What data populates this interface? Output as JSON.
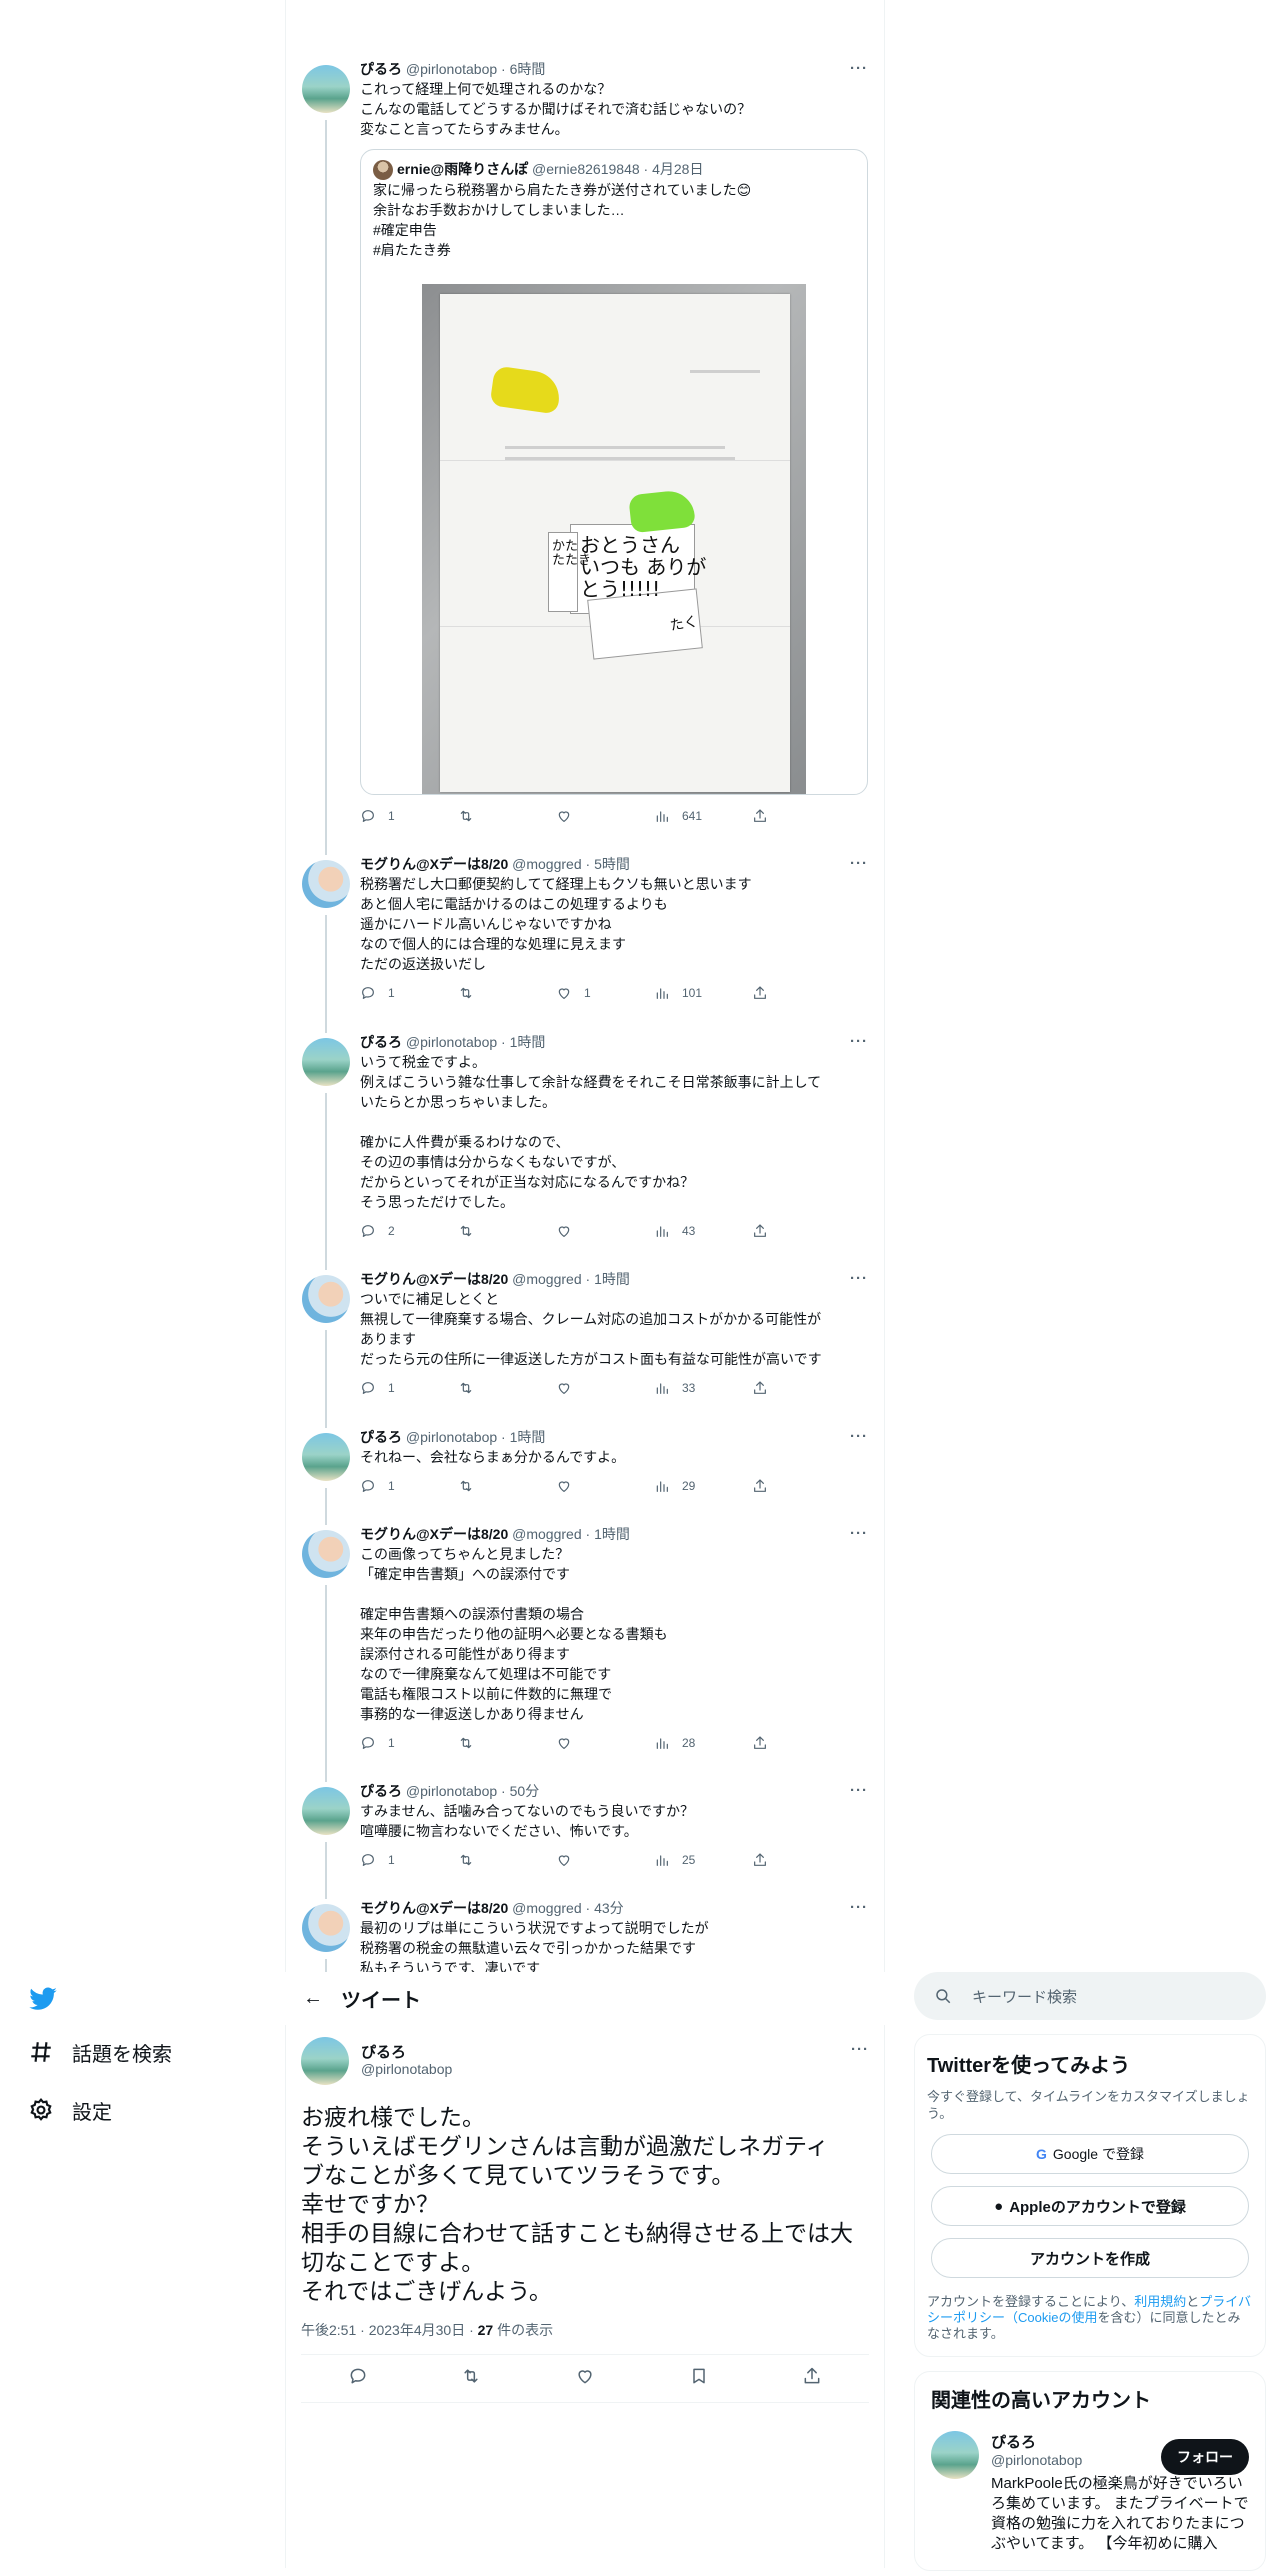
{
  "nav": {
    "explore_label": "話題を検索",
    "settings_label": "設定"
  },
  "header": {
    "title": "ツイート"
  },
  "thread": [
    {
      "name": "ぴるろ",
      "handle": "@pirlonotabop",
      "time": "6時間",
      "avatar": "pirlo",
      "text": "これって経理上何で処理されるのかな？\nこんなの電話してどうするか聞けばそれで済む話じゃないの？\n変なこと言ってたらすみません。",
      "quote": {
        "name": "ernie@雨降りさんぽ",
        "handle": "@ernie82619848",
        "time": "4月28日",
        "text": "家に帰ったら税務署から肩たたき券が送付されていました😊\n余計なお手数おかけしてしまいました…\n#確定申告\n#肩たたき券",
        "photo": {
          "card_left": "かた\nたたき",
          "card_main": "おとうさん\nいつも ありが\nとう!!!!!",
          "card_tail": "たく"
        }
      },
      "replies": "1",
      "retweets": "",
      "likes": "",
      "views": "641"
    },
    {
      "name": "モグりん@Xデーは8/20",
      "handle": "@moggred",
      "time": "5時間",
      "avatar": "mogg",
      "text": "税務署だし大口郵便契約してて経理上もクソも無いと思います\nあと個人宅に電話かけるのはこの処理するよりも\n遥かにハードル高いんじゃないですかね\nなので個人的には合理的な処理に見えます\nただの返送扱いだし",
      "replies": "1",
      "retweets": "",
      "likes": "1",
      "views": "101"
    },
    {
      "name": "ぴるろ",
      "handle": "@pirlonotabop",
      "time": "1時間",
      "avatar": "pirlo",
      "text": "いうて税金ですよ。\n例えばこういう雑な仕事して余計な経費をそれこそ日常茶飯事に計上して\nいたらとか思っちゃいました。\n\n確かに人件費が乗るわけなので、\nその辺の事情は分からなくもないですが、\nだからといってそれが正当な対応になるんですかね？\nそう思っただけでした。",
      "replies": "2",
      "retweets": "",
      "likes": "",
      "views": "43"
    },
    {
      "name": "モグりん@Xデーは8/20",
      "handle": "@moggred",
      "time": "1時間",
      "avatar": "mogg",
      "text": "ついでに補足しとくと\n無視して一律廃棄する場合、クレーム対応の追加コストがかかる可能性が\nあります\nだったら元の住所に一律返送した方がコスト面も有益な可能性が高いです",
      "replies": "1",
      "retweets": "",
      "likes": "",
      "views": "33"
    },
    {
      "name": "ぴるろ",
      "handle": "@pirlonotabop",
      "time": "1時間",
      "avatar": "pirlo",
      "text": "それねー、会社ならまぁ分かるんですよ。",
      "replies": "1",
      "retweets": "",
      "likes": "",
      "views": "29"
    },
    {
      "name": "モグりん@Xデーは8/20",
      "handle": "@moggred",
      "time": "1時間",
      "avatar": "mogg",
      "text": "この画像ってちゃんと見ました？\n「確定申告書類」への誤添付です\n\n確定申告書類への誤添付書類の場合\n来年の申告だったり他の証明へ必要となる書類も\n誤添付される可能性があり得ます\nなので一律廃棄なんて処理は不可能です\n電話も権限コスト以前に件数的に無理で\n事務的な一律返送しかあり得ません",
      "replies": "1",
      "retweets": "",
      "likes": "",
      "views": "28"
    },
    {
      "name": "ぴるろ",
      "handle": "@pirlonotabop",
      "time": "50分",
      "avatar": "pirlo",
      "text": "すみません、話噛み合ってないのでもう良いですか？\n喧嘩腰に物言わないでください、怖いです。",
      "replies": "1",
      "retweets": "",
      "likes": "",
      "views": "25"
    },
    {
      "name": "モグりん@Xデーは8/20",
      "handle": "@moggred",
      "time": "43分",
      "avatar": "mogg",
      "text": "最初のリプは単にこういう状況ですよって説明でしたが\n税務署の税金の無駄遣い云々で引っかかった結果です\n私もそういうです、凄いです"
    }
  ],
  "main": {
    "name": "ぴるろ",
    "handle": "@pirlonotabop",
    "text": "お疲れ様でした。\nそういえばモグリンさんは言動が過激だしネガティ\nブなことが多くて見ていてツラそうです。\n幸せですか？\n相手の目線に合わせて話すことも納得させる上では大\n切なことですよ。\nそれではごきげんよう。",
    "time": "午後2:51 · 2023年4月30日 · ",
    "views_count": "27",
    "views_label": " 件の表示"
  },
  "right": {
    "search_placeholder": "キーワード検索",
    "signup_title": "Twitterを使ってみよう",
    "signup_sub": "今すぐ登録して、タイムラインをカスタマイズしましょう。",
    "google_btn": "Google で登録",
    "apple_btn": "Appleのアカウントで登録",
    "create_btn": "アカウントを作成",
    "legal_pre": "アカウントを登録することにより、",
    "legal_link1": "利用規約",
    "legal_mid": "と",
    "legal_link2": "プライバシーポリシー（Cookieの使用",
    "legal_post": "を含む）に同意したとみなされます。",
    "related_title": "関連性の高いアカウント",
    "related_name": "ぴるろ",
    "related_handle": "@pirlonotabop",
    "follow_label": "フォロー",
    "related_bio": "MarkPoole氏の極楽鳥が好きでいろいろ集めています。 またプライベートで資格の勉強に力を入れておりたまにつぶやいてます。 【今年初めに購入"
  },
  "colors": {
    "twitter_blue": "#1d9bf0",
    "text_dark": "#0f1419",
    "text_muted": "#536471"
  }
}
